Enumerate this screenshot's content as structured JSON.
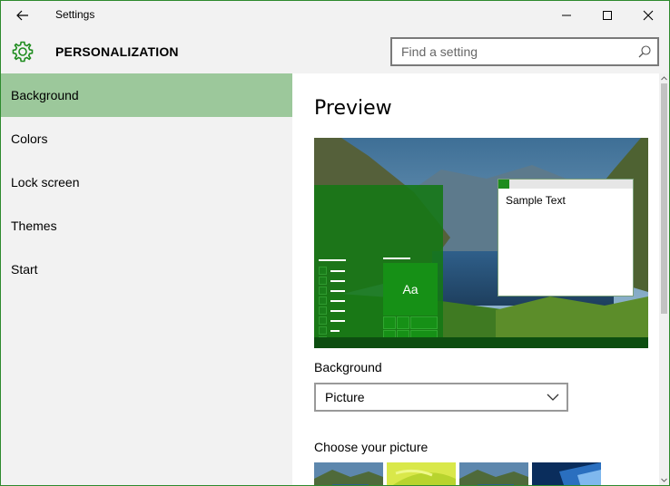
{
  "window": {
    "title": "Settings"
  },
  "header": {
    "title": "PERSONALIZATION",
    "search_placeholder": "Find a setting"
  },
  "sidebar": {
    "items": [
      {
        "label": "Background",
        "selected": true
      },
      {
        "label": "Colors",
        "selected": false
      },
      {
        "label": "Lock screen",
        "selected": false
      },
      {
        "label": "Themes",
        "selected": false
      },
      {
        "label": "Start",
        "selected": false
      }
    ]
  },
  "main": {
    "preview_title": "Preview",
    "preview": {
      "sample_text": "Sample Text",
      "tile_label": "Aa"
    },
    "background_label": "Background",
    "background_value": "Picture",
    "choose_picture_label": "Choose your picture"
  },
  "colors": {
    "accent": "#1e8c1e",
    "selected_nav": "#9cc89b",
    "chrome": "#f2f2f2",
    "border": "#2e8a2e"
  },
  "icons": {
    "back": "back-arrow-icon",
    "minimize": "minimize-icon",
    "maximize": "maximize-icon",
    "close": "close-icon",
    "gear": "gear-icon",
    "search": "search-icon",
    "dropdown": "chevron-down-icon"
  }
}
